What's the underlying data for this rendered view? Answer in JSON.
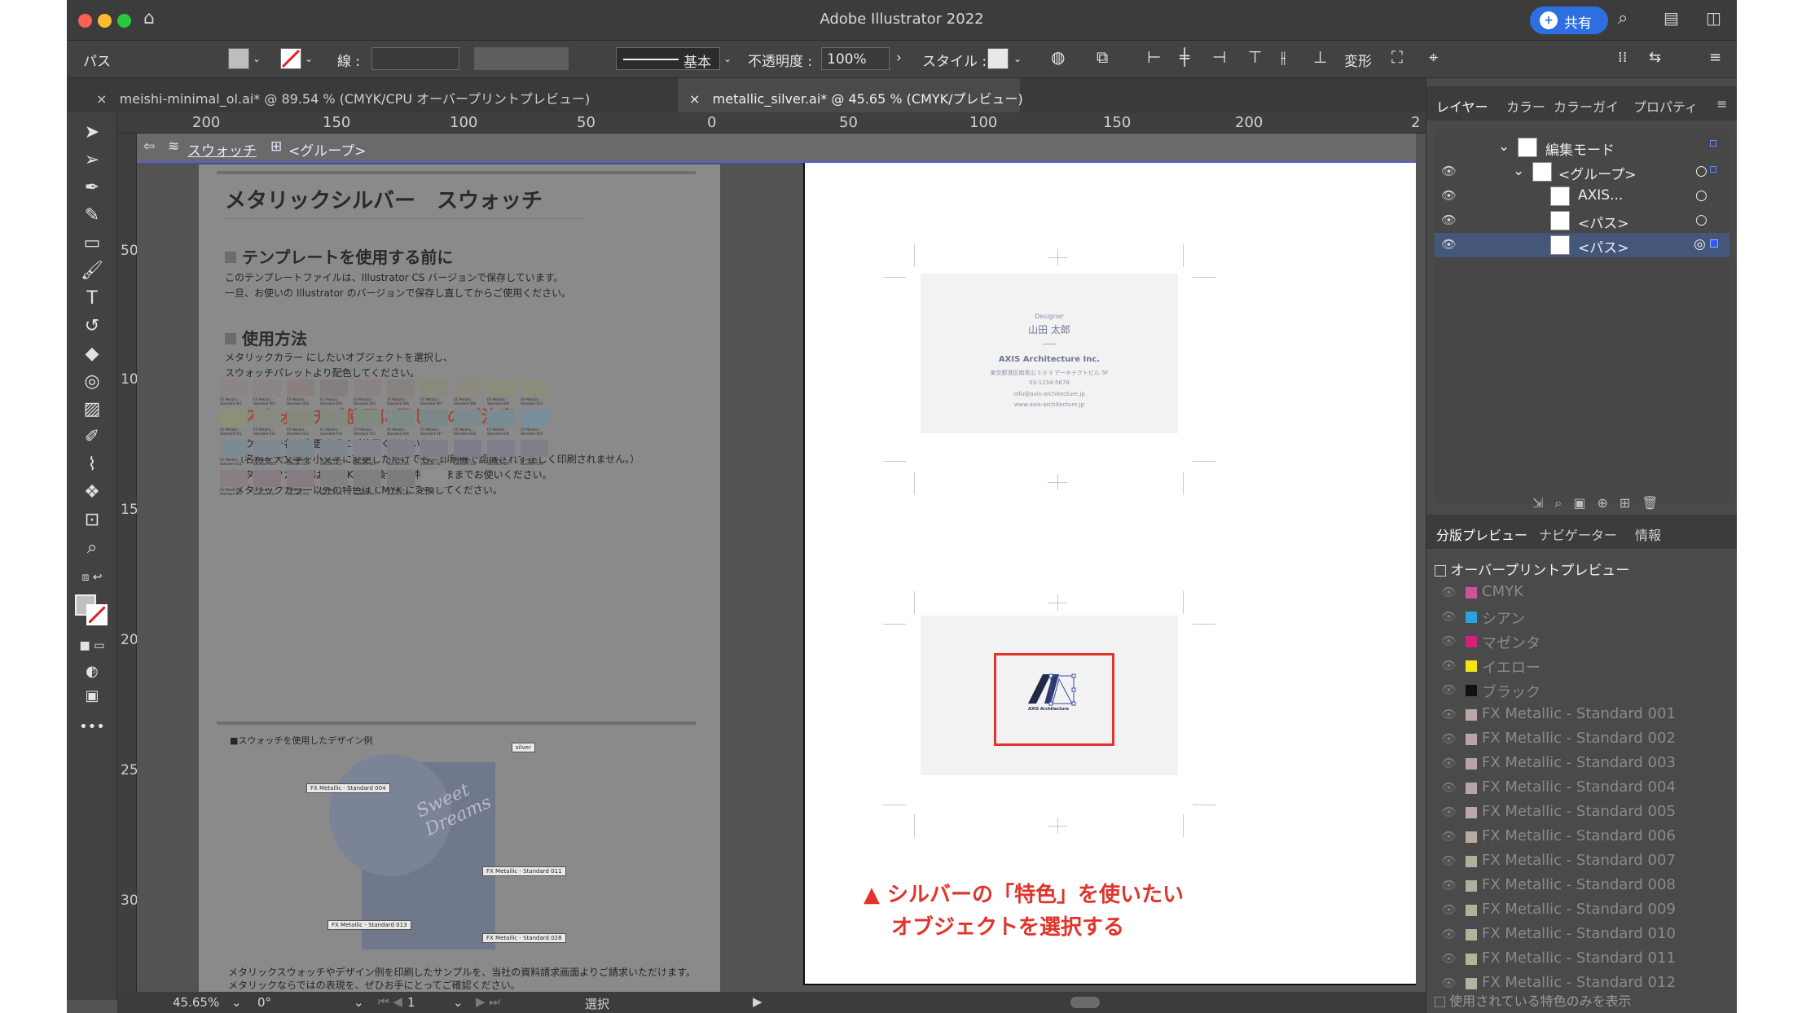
{
  "app": {
    "title": "Adobe Illustrator 2022",
    "share_label": "共有"
  },
  "controlbar": {
    "object_type": "パス",
    "stroke_label": "線 :",
    "brush_label": "基本",
    "opacity_label": "不透明度 :",
    "opacity_value": "100%",
    "style_label": "スタイル :",
    "transform_label": "変形"
  },
  "tabs": [
    {
      "label": "meishi-minimal_ol.ai* @ 89.54 % (CMYK/CPU オーバープリントプレビュー)",
      "close": "×"
    },
    {
      "label": "metallic_silver.ai* @ 45.65 % (CMYK/プレビュー)",
      "close": "×"
    }
  ],
  "ruler": {
    "h_ticks": [
      "200",
      "150",
      "100",
      "50",
      "0",
      "50",
      "100",
      "150",
      "200",
      "2"
    ],
    "v_ticks": [
      "50",
      "100",
      "150",
      "200",
      "250",
      "300"
    ]
  },
  "breadcrumb": {
    "layer": "スウォッチ",
    "group": "<グループ>"
  },
  "doc": {
    "title": "メタリックシルバー　スウォッチ",
    "sec1_title": "テンプレートを使用する前に",
    "sec1_lines": [
      "このテンプレートファイルは、Illustrator CS バージョンで保存しています。",
      "一旦、お使いの Illustrator のバージョンで保存し直してからご使用ください。"
    ],
    "sec2_title": "使用方法",
    "sec2_lines": [
      "メタリックカラー にしたいオブジェクトを選択し、",
      "スウォッチパレットより配色してください。"
    ],
    "sec3_title": "スウォッチご使用に際してのご注意",
    "sec3_lines": [
      "・スウォッチ名は変更せずにご使用ください。",
      "（名称を大文字を小文字に変更しただけでも、印刷機で認識されず正しく印刷されません。）",
      "・メタリックカラーは CMYK に変換せずに特色のままでお使いください。",
      "メタリックカラー以外の特色は CMYK に変換してください。"
    ],
    "example_title": "■スウォッチを使用したデザイン例",
    "example_labels": [
      "silver",
      "FX Metallic - Standard 004",
      "FX Metallic - Standard 011",
      "FX Metallic - Standard 013",
      "FX Metallic - Standard 028"
    ],
    "footer_lines": [
      "メタリックスウォッチやデザイン例を印刷したサンプルを、当社の資料請求画面よりご請求いただけます。",
      "メタリックならではの表現を、ぜひお手にとってご確認ください。"
    ],
    "swatches": [
      {
        "name": "FX Metallic - Standard 001",
        "color": "#8d8585"
      },
      {
        "name": "FX Metallic - Standard 002",
        "color": "#8c8484"
      },
      {
        "name": "FX Metallic - Standard 003",
        "color": "#8a8080"
      },
      {
        "name": "FX Metallic - Standard 004",
        "color": "#867d80"
      },
      {
        "name": "FX Metallic - Standard 005",
        "color": "#8b8284"
      },
      {
        "name": "FX Metallic - Standard 006",
        "color": "#878381"
      },
      {
        "name": "FX Metallic - Standard 007",
        "color": "#8a8a7c"
      },
      {
        "name": "FX Metallic - Standard 008",
        "color": "#8c8a80"
      },
      {
        "name": "FX Metallic - Standard 009",
        "color": "#8c8c7a"
      },
      {
        "name": "FX Metallic - Standard 010",
        "color": "#8b8c7c"
      },
      {
        "name": "FX Metallic - Standard 011",
        "color": "#8d9077"
      },
      {
        "name": "FX Metallic - Standard 012",
        "color": "#878a80"
      },
      {
        "name": "FX Metallic - Standard 013",
        "color": "#84887d"
      },
      {
        "name": "FX Metallic - Standard 014",
        "color": "#828a80"
      },
      {
        "name": "FX Metallic - Standard 015",
        "color": "#7f8a83"
      },
      {
        "name": "FX Metallic - Standard 016",
        "color": "#7d8a86"
      },
      {
        "name": "FX Metallic - Standard 017",
        "color": "#7b8888"
      },
      {
        "name": "FX Metallic - Standard 018",
        "color": "#7a8a8e"
      },
      {
        "name": "FX Metallic - Standard 019",
        "color": "#798c93"
      },
      {
        "name": "FX Metallic - Standard 020",
        "color": "#778f9a"
      },
      {
        "name": "FX Metallic - Standard 021",
        "color": "#7b8a93"
      },
      {
        "name": "FX Metallic - Standard 022",
        "color": "#7e8890"
      },
      {
        "name": "FX Metallic - Standard 023",
        "color": "#7c868e"
      },
      {
        "name": "FX Metallic - Standard 024",
        "color": "#80868c"
      },
      {
        "name": "FX Metallic - Standard 025",
        "color": "#828489"
      },
      {
        "name": "FX Metallic - Standard 026",
        "color": "#7f8088"
      },
      {
        "name": "FX Metallic - Standard 027",
        "color": "#807f8a"
      },
      {
        "name": "FX Metallic - Standard 028",
        "color": "#7d7c8a"
      },
      {
        "name": "FX Metallic - Standard 029",
        "color": "#817d8c"
      },
      {
        "name": "FX Metallic - Standard 030",
        "color": "#827d86"
      },
      {
        "name": "FX Metallic - Standard 031",
        "color": "#887e84"
      },
      {
        "name": "FX Metallic - Standard 032",
        "color": "#867a83"
      },
      {
        "name": "FX Metallic - Standard 033",
        "color": "#857c83"
      },
      {
        "name": "FX Metallic - Standard 034",
        "color": "#818181"
      },
      {
        "name": "FX Metallic - Standard 035",
        "color": "#7f7f7f"
      },
      {
        "name": "FX Metallic - Standard 036",
        "color": "#7c7c7c"
      },
      {
        "name": "Silver",
        "color": "#8e8e8e"
      }
    ]
  },
  "card1": {
    "role": "Designer",
    "name": "山田 太郎",
    "company": "AXIS Architecture Inc.",
    "address": "東京都港区南青山 1-2-3 アーキテクトビル 5F",
    "phone": "03-1234-5678",
    "email": "info@axis-architecture.jp",
    "web": "www.axis-architecture.jp"
  },
  "card2": {
    "logo_text": "AXIS Architecture"
  },
  "annotation": {
    "line1": "▲ シルバーの「特色」を使いたい",
    "line2": "オブジェクトを選択する"
  },
  "layers_panel": {
    "tabs": [
      "レイヤー",
      "カラー",
      "カラーガイ",
      "プロパティ"
    ],
    "rows": [
      {
        "label": "編集モード",
        "expand": "⌄"
      },
      {
        "label": "<グループ>",
        "expand": "⌄"
      },
      {
        "label": "AXIS..."
      },
      {
        "label": "<パス>"
      },
      {
        "label": "<パス>"
      }
    ]
  },
  "sep_panel": {
    "tabs": [
      "分版プレビュー",
      "ナビゲーター",
      "情報"
    ],
    "overprint_label": "オーバープリントプレビュー",
    "plates": [
      {
        "name": "CMYK",
        "color": "#cc5599"
      },
      {
        "name": "シアン",
        "color": "#29a4e0"
      },
      {
        "name": "マゼンタ",
        "color": "#d4207a"
      },
      {
        "name": "イエロー",
        "color": "#f6e312"
      },
      {
        "name": "ブラック",
        "color": "#111111"
      },
      {
        "name": "FX Metallic - Standard 001",
        "color": "#b9a6a6"
      },
      {
        "name": "FX Metallic - Standard 002",
        "color": "#b8a3a7"
      },
      {
        "name": "FX Metallic - Standard 003",
        "color": "#b8a4a8"
      },
      {
        "name": "FX Metallic - Standard 004",
        "color": "#b6a5a5"
      },
      {
        "name": "FX Metallic - Standard 005",
        "color": "#b7a9a4"
      },
      {
        "name": "FX Metallic - Standard 006",
        "color": "#b5aba1"
      },
      {
        "name": "FX Metallic - Standard 007",
        "color": "#b4ae9f"
      },
      {
        "name": "FX Metallic - Standard 008",
        "color": "#b2b09c"
      },
      {
        "name": "FX Metallic - Standard 009",
        "color": "#b1b29a"
      },
      {
        "name": "FX Metallic - Standard 010",
        "color": "#b0b49a"
      },
      {
        "name": "FX Metallic - Standard 011",
        "color": "#b0b69a"
      },
      {
        "name": "FX Metallic - Standard 012",
        "color": "#aeb59d"
      }
    ],
    "used_only_label": "使用されている特色のみを表示"
  },
  "status": {
    "zoom": "45.65%",
    "rotation": "0°",
    "artboard_num": "1",
    "tool_name": "選択"
  }
}
